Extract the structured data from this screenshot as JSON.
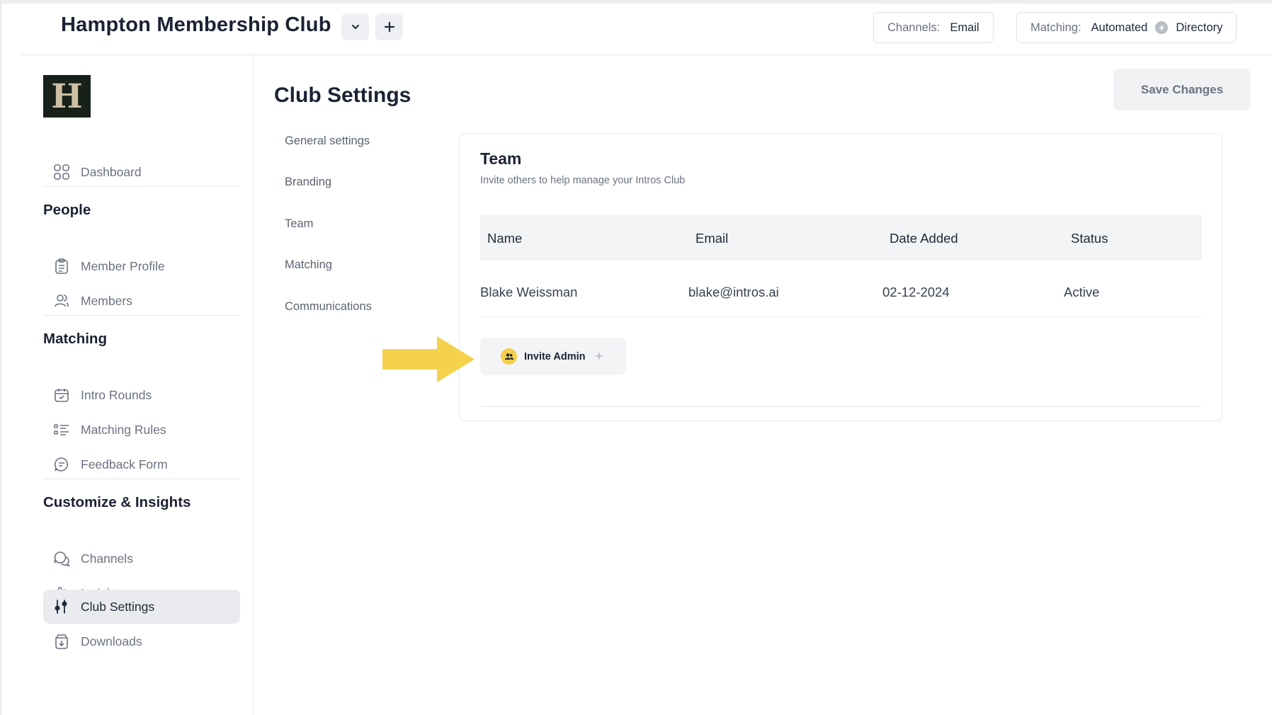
{
  "header": {
    "club_name": "Hampton Membership Club",
    "channels_label": "Channels:",
    "channels_value": "Email",
    "matching_label": "Matching:",
    "matching_value_1": "Automated",
    "matching_value_2": "Directory"
  },
  "sidebar": {
    "logo_letter": "H",
    "dashboard": "Dashboard",
    "sections": {
      "people": "People",
      "matching": "Matching",
      "customize": "Customize & Insights"
    },
    "items": {
      "member_profile": "Member Profile",
      "members": "Members",
      "intro_rounds": "Intro Rounds",
      "matching_rules": "Matching Rules",
      "feedback_form": "Feedback Form",
      "channels": "Channels",
      "insights": "Insights",
      "club_settings": "Club Settings",
      "downloads": "Downloads"
    },
    "active": "Club Settings"
  },
  "main": {
    "title": "Club Settings",
    "save_label": "Save Changes",
    "subnav": [
      "General settings",
      "Branding",
      "Team",
      "Matching",
      "Communications"
    ]
  },
  "team": {
    "title": "Team",
    "subtitle": "Invite others to help manage your Intros Club",
    "columns": [
      "Name",
      "Email",
      "Date Added",
      "Status"
    ],
    "rows": [
      [
        "Blake Weissman",
        "blake@intros.ai",
        "02-12-2024",
        "Active"
      ]
    ],
    "invite_label": "Invite Admin"
  },
  "colors": {
    "accent_yellow": "#f5cf4a",
    "arrow_yellow": "#f4d24c",
    "logo_bg": "#172019",
    "logo_fg": "#cdbfa2"
  }
}
